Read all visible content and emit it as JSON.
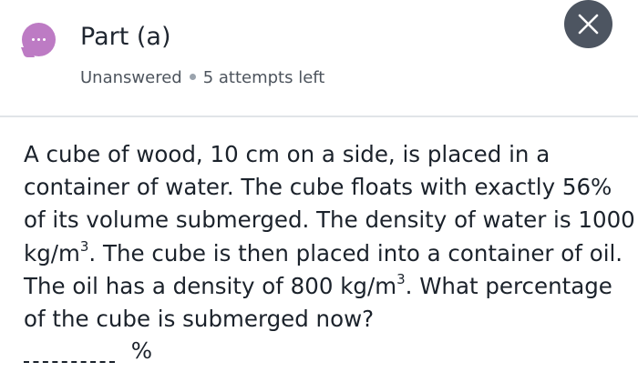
{
  "header": {
    "icon": "chat-bubble-dots-icon",
    "icon_color": "#bd7bc4",
    "part_title": "Part (a)",
    "status": "Unanswered",
    "attempts": "5 attempts left",
    "close_icon": "close-icon",
    "close_button_color": "#4d5561"
  },
  "question": {
    "line1": "A cube of wood, 10 cm on a side, is placed in a",
    "line2": "container of water. The cube floats with exactly 56%",
    "line3": "of its volume submerged. The density of water is 1000",
    "line4_unit_base": "kg/m",
    "line4_unit_exp": "3",
    "line4_rest": ". The cube is then placed into a container of oil.",
    "line5_pre": "The oil has a density of 800 kg/m",
    "line5_exp": "3",
    "line5_post": ". What percentage",
    "line6": "of the cube is submerged now?"
  },
  "answer": {
    "value": "",
    "unit": "%"
  }
}
